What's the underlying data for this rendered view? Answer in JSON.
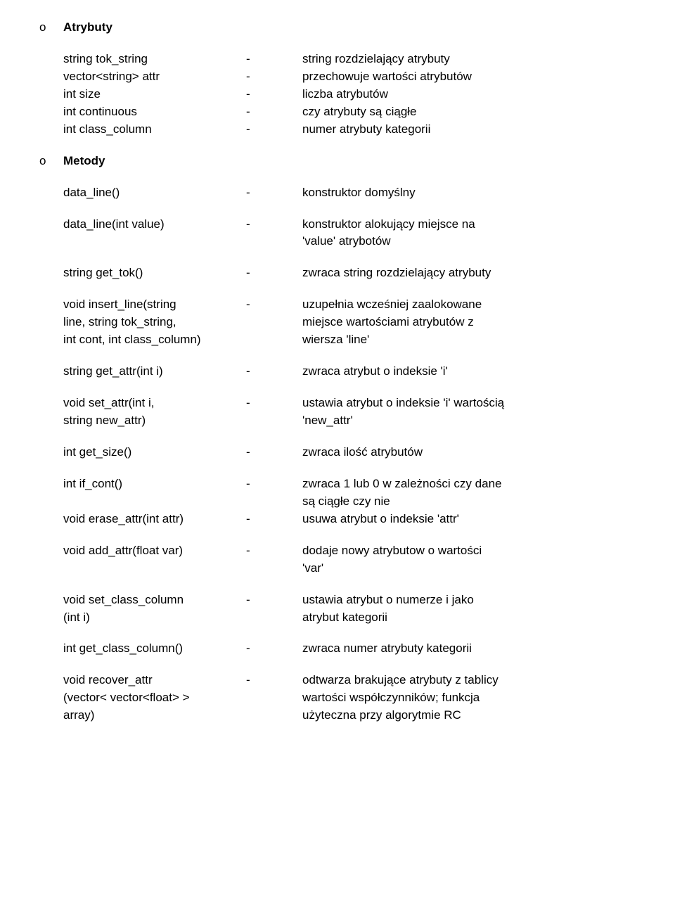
{
  "headings": {
    "bullet": "o",
    "attributes": "Atrybuty",
    "methods": "Metody"
  },
  "dash": "-",
  "attributes": [
    {
      "name": "string tok_string",
      "desc": "string rozdzielający atrybuty"
    },
    {
      "name": "vector<string> attr",
      "desc": "przechowuje wartości atrybutów"
    },
    {
      "name": "int size",
      "desc": "liczba atrybutów"
    },
    {
      "name": "int continuous",
      "desc": "czy atrybuty są ciągłe"
    },
    {
      "name": "int class_column",
      "desc": "numer atrybuty kategorii"
    }
  ],
  "methods": [
    {
      "name": [
        "data_line()"
      ],
      "desc": [
        "konstruktor domyślny"
      ]
    },
    {
      "name": [
        "data_line(int value)"
      ],
      "desc": [
        "konstruktor alokujący miejsce na",
        "'value' atrybotów"
      ]
    },
    {
      "name": [
        "string get_tok()"
      ],
      "desc": [
        "zwraca string rozdzielający atrybuty"
      ]
    },
    {
      "name": [
        "void insert_line(string",
        "line, string tok_string,",
        "int cont, int class_column)"
      ],
      "desc": [
        "uzupełnia wcześniej zaalokowane",
        "miejsce wartościami atrybutów z",
        "wiersza 'line'"
      ]
    },
    {
      "name": [
        "string get_attr(int i)"
      ],
      "desc": [
        "zwraca atrybut o indeksie 'i'"
      ]
    },
    {
      "name": [
        "void set_attr(int i,",
        "string new_attr)"
      ],
      "desc": [
        "ustawia atrybut o indeksie 'i' wartością",
        "'new_attr'"
      ]
    },
    {
      "name": [
        "int get_size()"
      ],
      "desc": [
        "zwraca ilość atrybutów"
      ]
    },
    {
      "name": [
        "int if_cont()",
        "",
        "void erase_attr(int attr)"
      ],
      "desc": [
        "zwraca 1 lub 0 w zależności czy dane",
        "są ciągłe czy nie",
        "usuwa atrybut o indeksie 'attr'"
      ],
      "dashRows": [
        0,
        2
      ]
    },
    {
      "name": [
        "void add_attr(float var)"
      ],
      "desc": [
        "dodaje nowy atrybutow o wartości",
        "'var'"
      ]
    },
    {
      "name": [
        "void set_class_column",
        "(int i)"
      ],
      "desc": [
        "ustawia atrybut o numerze i jako",
        "atrybut kategorii"
      ]
    },
    {
      "name": [
        "int get_class_column()"
      ],
      "desc": [
        "zwraca numer atrybuty kategorii"
      ]
    },
    {
      "name": [
        "void recover_attr",
        "(vector< vector<float> >",
        "array)"
      ],
      "desc": [
        "odtwarza brakujące atrybuty z tablicy",
        "wartości współczynników; funkcja",
        "użyteczna przy algorytmie RC"
      ]
    }
  ]
}
